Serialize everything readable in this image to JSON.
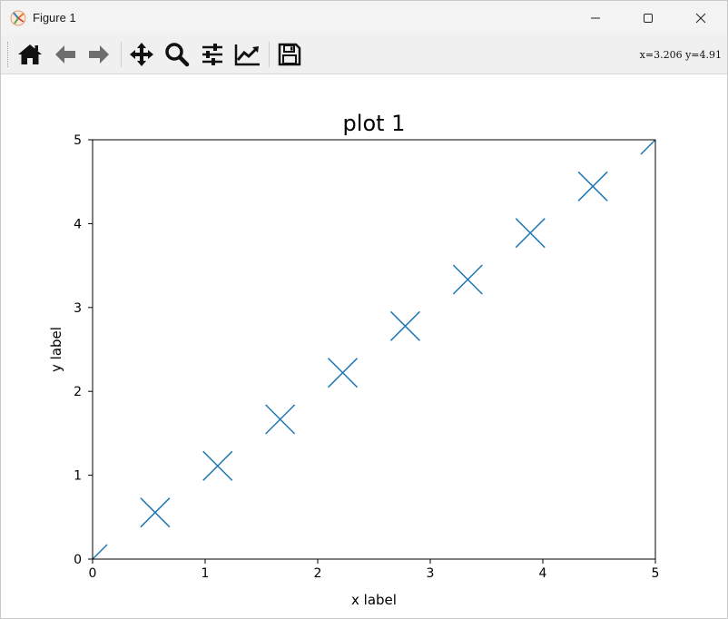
{
  "window": {
    "title": "Figure 1",
    "app_icon": "matplotlib-figure-icon",
    "controls": [
      "minimize-icon",
      "maximize-icon",
      "close-icon"
    ]
  },
  "toolbar": {
    "buttons": [
      {
        "name": "home-button",
        "icon": "home-icon"
      },
      {
        "name": "back-button",
        "icon": "arrow-left-icon"
      },
      {
        "name": "forward-button",
        "icon": "arrow-right-icon"
      },
      {
        "name": "pan-button",
        "icon": "move-arrows-icon"
      },
      {
        "name": "zoom-button",
        "icon": "magnifier-icon"
      },
      {
        "name": "configure-subplots-button",
        "icon": "sliders-icon"
      },
      {
        "name": "edit-axis-button",
        "icon": "line-chart-icon"
      },
      {
        "name": "save-button",
        "icon": "floppy-disk-icon"
      }
    ],
    "coordinates": "x=3.206 y=4.91"
  },
  "chart_data": {
    "type": "line",
    "title": "plot 1",
    "xlabel": "x label",
    "ylabel": "y label",
    "xlim": [
      0,
      5
    ],
    "ylim": [
      0,
      5
    ],
    "xticks": [
      "0",
      "1",
      "2",
      "3",
      "4",
      "5"
    ],
    "yticks": [
      "0",
      "1",
      "2",
      "3",
      "4",
      "5"
    ],
    "grid": false,
    "series": [
      {
        "color": "#1f77b4",
        "marker": "x",
        "x": [
          0,
          0.5556,
          1.1111,
          1.6667,
          2.2222,
          2.7778,
          3.3333,
          3.8889,
          4.4444,
          5
        ],
        "y": [
          0,
          0.5556,
          1.1111,
          1.6667,
          2.2222,
          2.7778,
          3.3333,
          3.8889,
          4.4444,
          5
        ]
      }
    ]
  }
}
